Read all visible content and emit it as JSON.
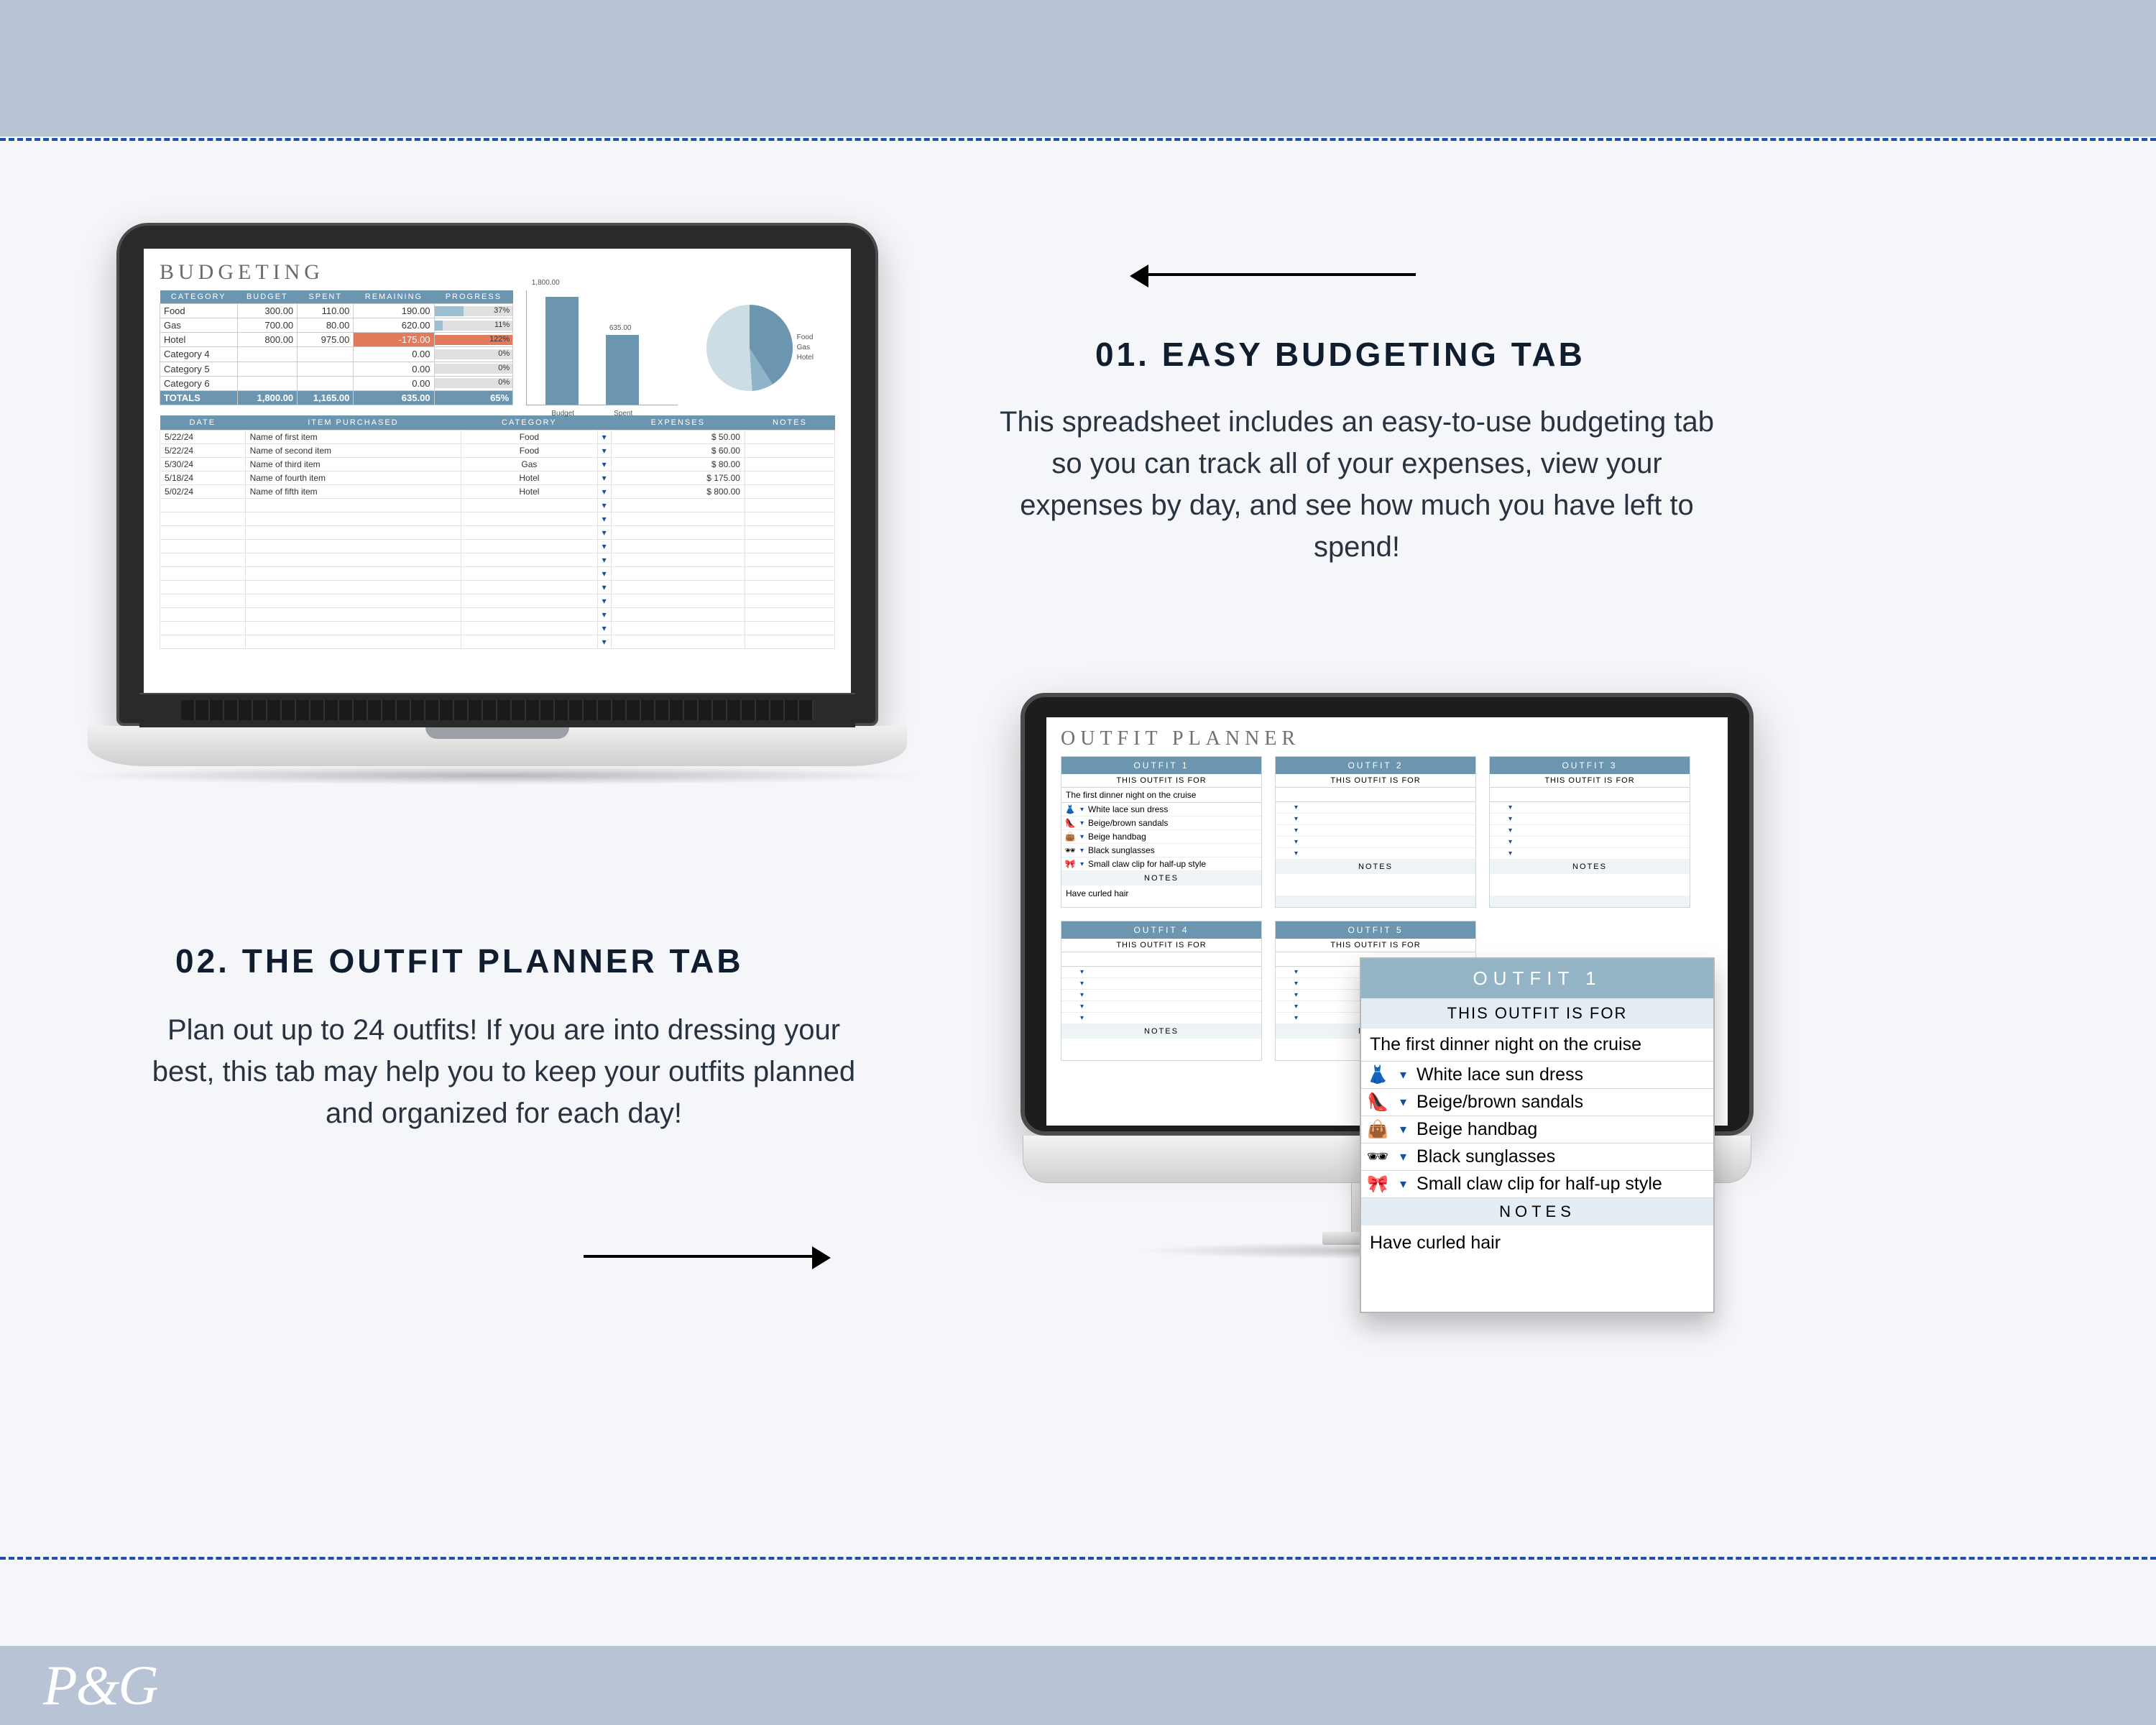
{
  "section1": {
    "title": "01. EASY BUDGETING TAB",
    "body": "This spreadsheet includes an easy-to-use budgeting tab so you can track all of your expenses, view your expenses by day, and see how much you have left to spend!"
  },
  "section2": {
    "title": "02. THE OUTFIT PLANNER TAB",
    "body": "Plan out up to 24 outfits! If you are into dressing your best, this tab may help you to keep your outfits planned and organized for each day!"
  },
  "footer_brand": "P&G",
  "budget": {
    "title": "BUDGETING",
    "cat_headers": [
      "CATEGORY",
      "BUDGET",
      "SPENT",
      "REMAINING",
      "PROGRESS"
    ],
    "categories": [
      {
        "name": "Food",
        "budget": "300.00",
        "spent": "110.00",
        "remaining": "190.00",
        "pct": 37
      },
      {
        "name": "Gas",
        "budget": "700.00",
        "spent": "80.00",
        "remaining": "620.00",
        "pct": 11
      },
      {
        "name": "Hotel",
        "budget": "800.00",
        "spent": "975.00",
        "remaining": "-175.00",
        "pct": 122
      },
      {
        "name": "Category 4",
        "budget": "",
        "spent": "",
        "remaining": "0.00",
        "pct": 0
      },
      {
        "name": "Category 5",
        "budget": "",
        "spent": "",
        "remaining": "0.00",
        "pct": 0
      },
      {
        "name": "Category 6",
        "budget": "",
        "spent": "",
        "remaining": "0.00",
        "pct": 0
      }
    ],
    "totals_lbl": "TOTALS",
    "totals": {
      "budget": "1,800.00",
      "spent": "1,165.00",
      "remaining": "635.00",
      "pct": 65
    },
    "list_headers": [
      "DATE",
      "ITEM PURCHASED",
      "CATEGORY",
      "",
      "EXPENSES",
      "NOTES"
    ],
    "items": [
      {
        "date": "5/22/24",
        "item": "Name of first item",
        "cat": "Food",
        "amt": "50.00"
      },
      {
        "date": "5/22/24",
        "item": "Name of second item",
        "cat": "Food",
        "amt": "60.00"
      },
      {
        "date": "5/30/24",
        "item": "Name of third item",
        "cat": "Gas",
        "amt": "80.00"
      },
      {
        "date": "5/18/24",
        "item": "Name of fourth item",
        "cat": "Hotel",
        "amt": "175.00"
      },
      {
        "date": "5/02/24",
        "item": "Name of fifth item",
        "cat": "Hotel",
        "amt": "800.00"
      }
    ]
  },
  "chart_data": {
    "bar": {
      "type": "bar",
      "title": "",
      "categories": [
        "Budget",
        "Spent"
      ],
      "values": [
        1800.0,
        1165.0
      ],
      "ylim": [
        0,
        1800
      ],
      "ymax_label": "1,800.00",
      "val_label": "635.00"
    },
    "pie": {
      "type": "pie",
      "series": [
        {
          "name": "Food",
          "value": 300,
          "pct": 17
        },
        {
          "name": "Gas",
          "value": 700,
          "pct": 39
        },
        {
          "name": "Hotel",
          "value": 800,
          "pct": 44
        }
      ],
      "legend": [
        "Food",
        "Gas",
        "Hotel"
      ]
    }
  },
  "outfits": {
    "title": "OUTFIT PLANNER",
    "sub_label": "THIS OUTFIT IS FOR",
    "notes_label": "NOTES",
    "cards": [
      {
        "n": "OUTFIT 1",
        "for": "The first dinner night on the cruise",
        "items": [
          {
            "icon": "👗",
            "txt": "White lace sun dress"
          },
          {
            "icon": "👠",
            "txt": "Beige/brown sandals"
          },
          {
            "icon": "👜",
            "txt": "Beige handbag"
          },
          {
            "icon": "🕶",
            "txt": "Black sunglasses"
          },
          {
            "icon": "🎀",
            "txt": "Small claw clip for half-up style"
          }
        ],
        "notes": "Have curled hair"
      },
      {
        "n": "OUTFIT 2",
        "for": "",
        "items": [
          {
            "icon": "",
            "txt": ""
          },
          {
            "icon": "",
            "txt": ""
          },
          {
            "icon": "",
            "txt": ""
          },
          {
            "icon": "",
            "txt": ""
          },
          {
            "icon": "",
            "txt": ""
          }
        ],
        "notes": ""
      },
      {
        "n": "OUTFIT 3",
        "for": "",
        "items": [
          {
            "icon": "",
            "txt": ""
          },
          {
            "icon": "",
            "txt": ""
          },
          {
            "icon": "",
            "txt": ""
          },
          {
            "icon": "",
            "txt": ""
          },
          {
            "icon": "",
            "txt": ""
          }
        ],
        "notes": ""
      },
      {
        "n": "OUTFIT 4",
        "for": "",
        "items": [
          {
            "icon": "",
            "txt": ""
          },
          {
            "icon": "",
            "txt": ""
          },
          {
            "icon": "",
            "txt": ""
          },
          {
            "icon": "",
            "txt": ""
          },
          {
            "icon": "",
            "txt": ""
          }
        ],
        "notes": ""
      },
      {
        "n": "OUTFIT 5",
        "for": "",
        "items": [
          {
            "icon": "",
            "txt": ""
          },
          {
            "icon": "",
            "txt": ""
          },
          {
            "icon": "",
            "txt": ""
          },
          {
            "icon": "",
            "txt": ""
          },
          {
            "icon": "",
            "txt": ""
          }
        ],
        "notes": ""
      }
    ]
  },
  "popout": {
    "hdr": "OUTFIT 1",
    "sub": "THIS OUTFIT IS FOR",
    "for": "The first dinner night on the cruise",
    "items": [
      {
        "icon": "👗",
        "txt": "White lace sun dress"
      },
      {
        "icon": "👠",
        "txt": "Beige/brown sandals"
      },
      {
        "icon": "👜",
        "txt": "Beige handbag"
      },
      {
        "icon": "🕶",
        "txt": "Black sunglasses"
      },
      {
        "icon": "🎀",
        "txt": "Small claw clip for half-up style"
      }
    ],
    "notes_label": "NOTES",
    "notes": "Have curled hair"
  }
}
